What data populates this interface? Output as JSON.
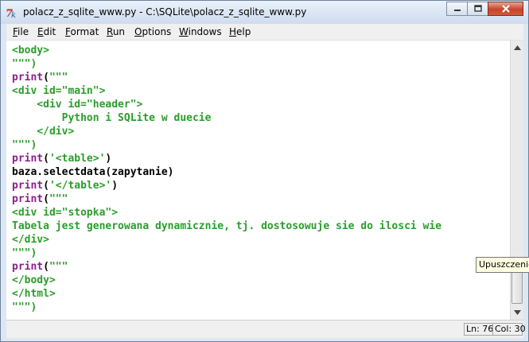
{
  "window": {
    "title": "polacz_z_sqlite_www.py - C:\\SQLite\\polacz_z_sqlite_www.py",
    "app_icon": "idle-feather-icon",
    "controls": [
      "minimize-icon",
      "maximize-icon",
      "close-icon"
    ]
  },
  "menu": [
    {
      "underline": "F",
      "rest": "ile"
    },
    {
      "underline": "E",
      "rest": "dit"
    },
    {
      "underline": "F",
      "rest": "ormat"
    },
    {
      "underline": "R",
      "rest": "un"
    },
    {
      "underline": "O",
      "rest": "ptions"
    },
    {
      "underline": "W",
      "rest": "indows"
    },
    {
      "underline": "H",
      "rest": "elp"
    }
  ],
  "code": {
    "lines": [
      [
        {
          "t": "<body>",
          "c": "str"
        }
      ],
      [
        {
          "t": "\"\"\")",
          "c": "str"
        }
      ],
      [
        {
          "t": "print",
          "c": "kw"
        },
        {
          "t": "(",
          "c": "plain"
        },
        {
          "t": "\"\"\"",
          "c": "str"
        }
      ],
      [
        {
          "t": "<div id=\"main\">",
          "c": "str"
        }
      ],
      [
        {
          "t": "    <div id=\"header\">",
          "c": "str"
        }
      ],
      [
        {
          "t": "        Python i SQLite w duecie",
          "c": "str"
        }
      ],
      [
        {
          "t": "    </div>",
          "c": "str"
        }
      ],
      [
        {
          "t": "\"\"\")",
          "c": "str"
        }
      ],
      [
        {
          "t": "print",
          "c": "kw"
        },
        {
          "t": "(",
          "c": "plain"
        },
        {
          "t": "'<table>'",
          "c": "str"
        },
        {
          "t": ")",
          "c": "plain"
        }
      ],
      [
        {
          "t": "baza.selectdata(zapytanie)",
          "c": "plain"
        }
      ],
      [
        {
          "t": "print",
          "c": "kw"
        },
        {
          "t": "(",
          "c": "plain"
        },
        {
          "t": "'</table>'",
          "c": "str"
        },
        {
          "t": ")",
          "c": "plain"
        }
      ],
      [
        {
          "t": "print",
          "c": "kw"
        },
        {
          "t": "(",
          "c": "plain"
        },
        {
          "t": "\"\"\"",
          "c": "str"
        }
      ],
      [
        {
          "t": "<div id=\"stopka\">",
          "c": "str"
        }
      ],
      [
        {
          "t": "Tabela jest generowana dynamicznie, tj. dostosowuje sie do ilosci wie",
          "c": "str"
        }
      ],
      [
        {
          "t": "</div>",
          "c": "str"
        }
      ],
      [
        {
          "t": "\"\"\")",
          "c": "str"
        }
      ],
      [
        {
          "t": "print",
          "c": "kw"
        },
        {
          "t": "(",
          "c": "plain"
        },
        {
          "t": "\"\"\"",
          "c": "str"
        }
      ],
      [
        {
          "t": "</body>",
          "c": "str"
        }
      ],
      [
        {
          "t": "</html>",
          "c": "str"
        }
      ],
      [
        {
          "t": "\"\"\")",
          "c": "str"
        }
      ]
    ]
  },
  "status": {
    "line": "Ln: 76",
    "col": "Col: 30"
  },
  "tooltip": {
    "text": "Upuszczenie"
  },
  "colors": {
    "string": "#2a9d2a",
    "keyword": "#8b1f8b",
    "plain": "#000000"
  }
}
